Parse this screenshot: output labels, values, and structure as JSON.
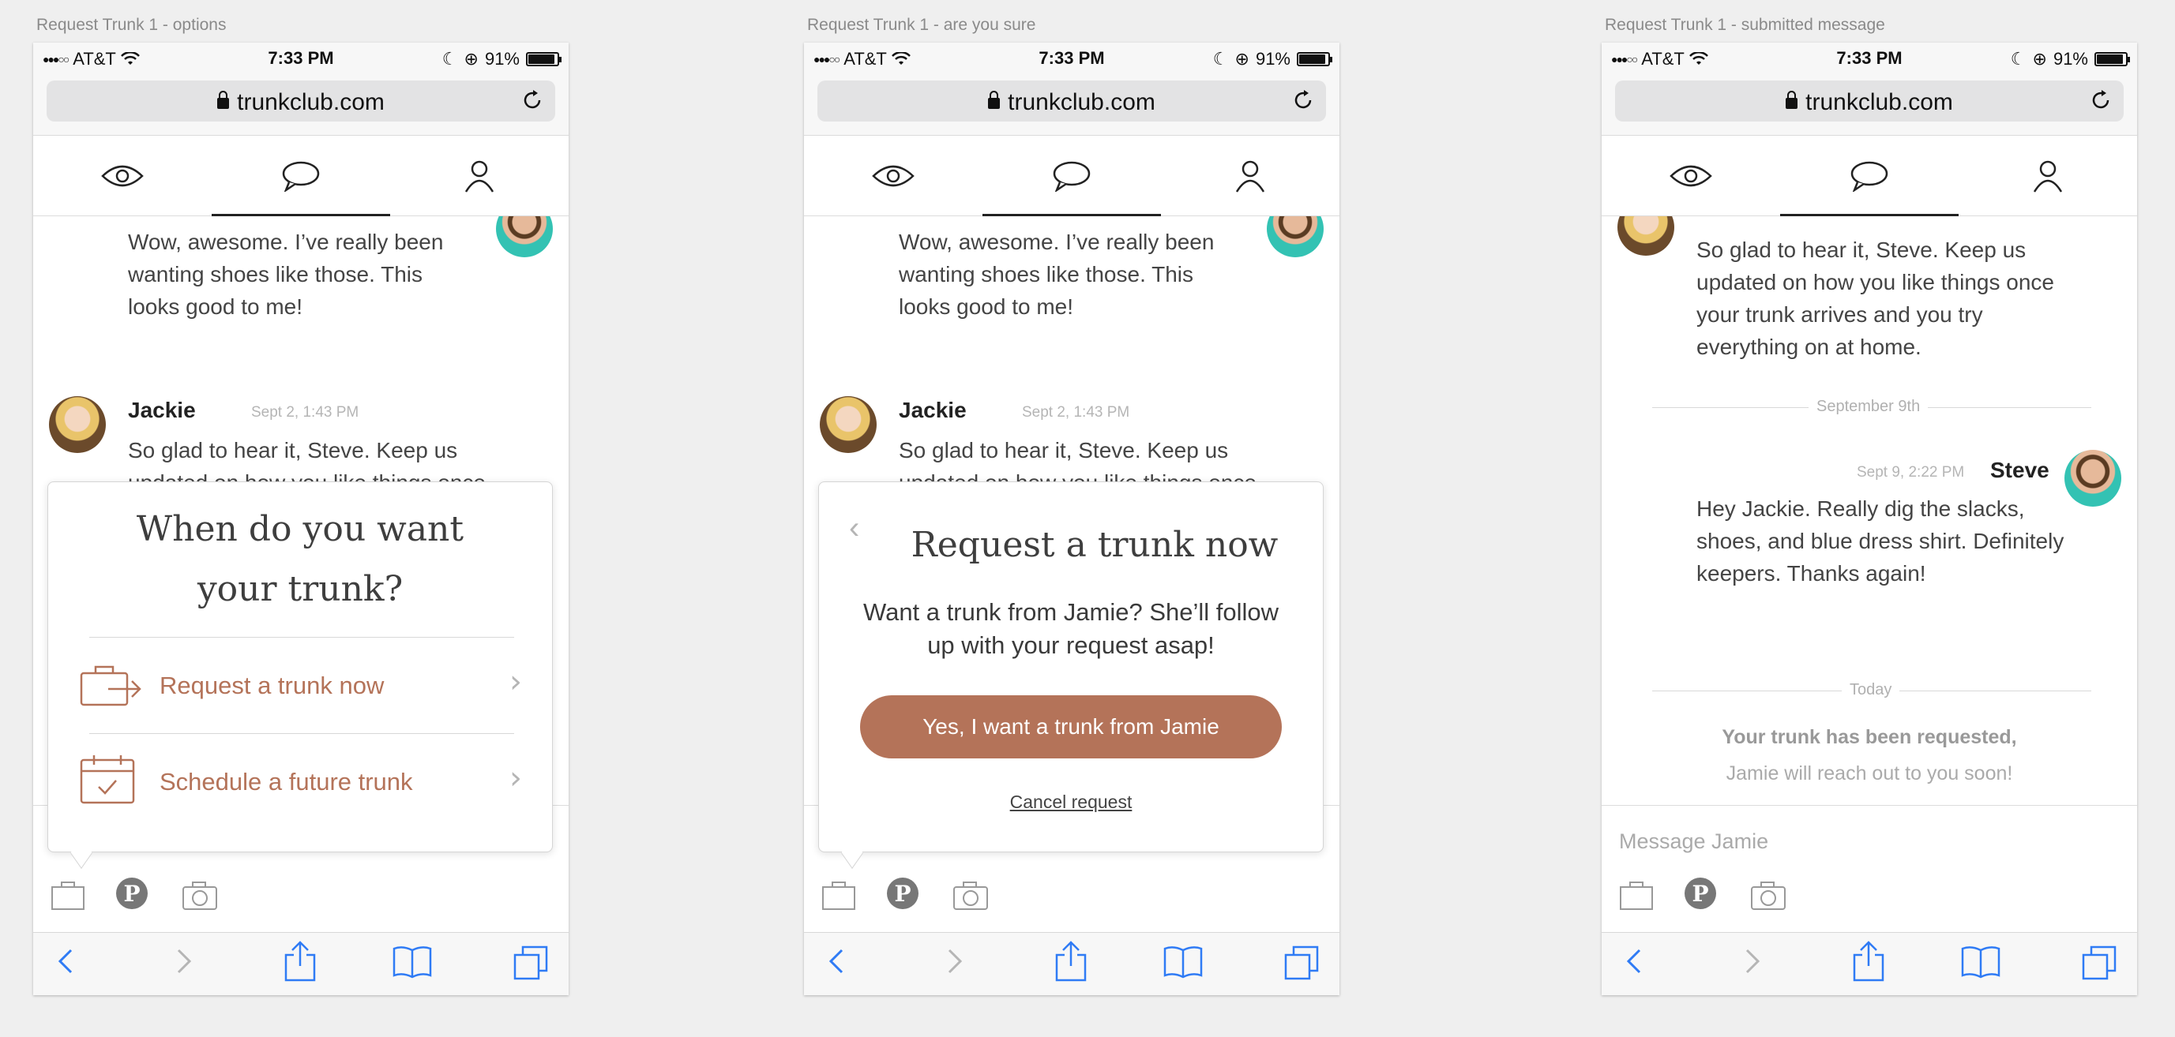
{
  "boards": [
    {
      "label": "Request Trunk 1 - options"
    },
    {
      "label": "Request Trunk 1 - are you sure"
    },
    {
      "label": "Request Trunk 1 - submitted message"
    }
  ],
  "statusbar": {
    "carrier": "AT&T",
    "time": "7:33 PM",
    "battery": "91%"
  },
  "browser": {
    "url": "trunkclub.com"
  },
  "tabs": [
    "eye-icon",
    "chat-icon",
    "profile-icon"
  ],
  "chat": {
    "steve_name": "Steve",
    "steve_msg1": "Wow, awesome. I’ve really been wanting shoes like those. This looks good to me!",
    "jackie_name": "Jackie",
    "jackie_ts": "Sept 2, 1:43 PM",
    "jackie_msg": "So glad to hear it, Steve. Keep us updated on how you like things once your trunk arrives and you try everything on at home.",
    "top_faded": "looks good to me!",
    "top_faded_jackie_ts": "Sept 2, 1:43 PM",
    "divider1": "September 9th",
    "steve_ts2": "Sept 9, 2:22 PM",
    "steve_msg2": "Hey Jackie. Really dig the slacks, shoes, and blue dress shirt. Definitely keepers. Thanks again!",
    "divider2": "Today",
    "notice_bold": "Your trunk has been requested,",
    "notice_sub": "Jamie will reach out to you soon!"
  },
  "options_popup": {
    "title": "When do you want your trunk?",
    "option1": "Request a trunk now",
    "option2": "Schedule a future trunk"
  },
  "sure_popup": {
    "title": "Request a trunk now",
    "body": "Want a trunk from Jamie? She’ll follow up with your request asap!",
    "cta": "Yes, I want a trunk from Jamie",
    "cancel": "Cancel request"
  },
  "composer": {
    "placeholder": "Message Jamie"
  },
  "colors": {
    "accent": "#b47359",
    "ios_blue": "#2f7bf5"
  }
}
